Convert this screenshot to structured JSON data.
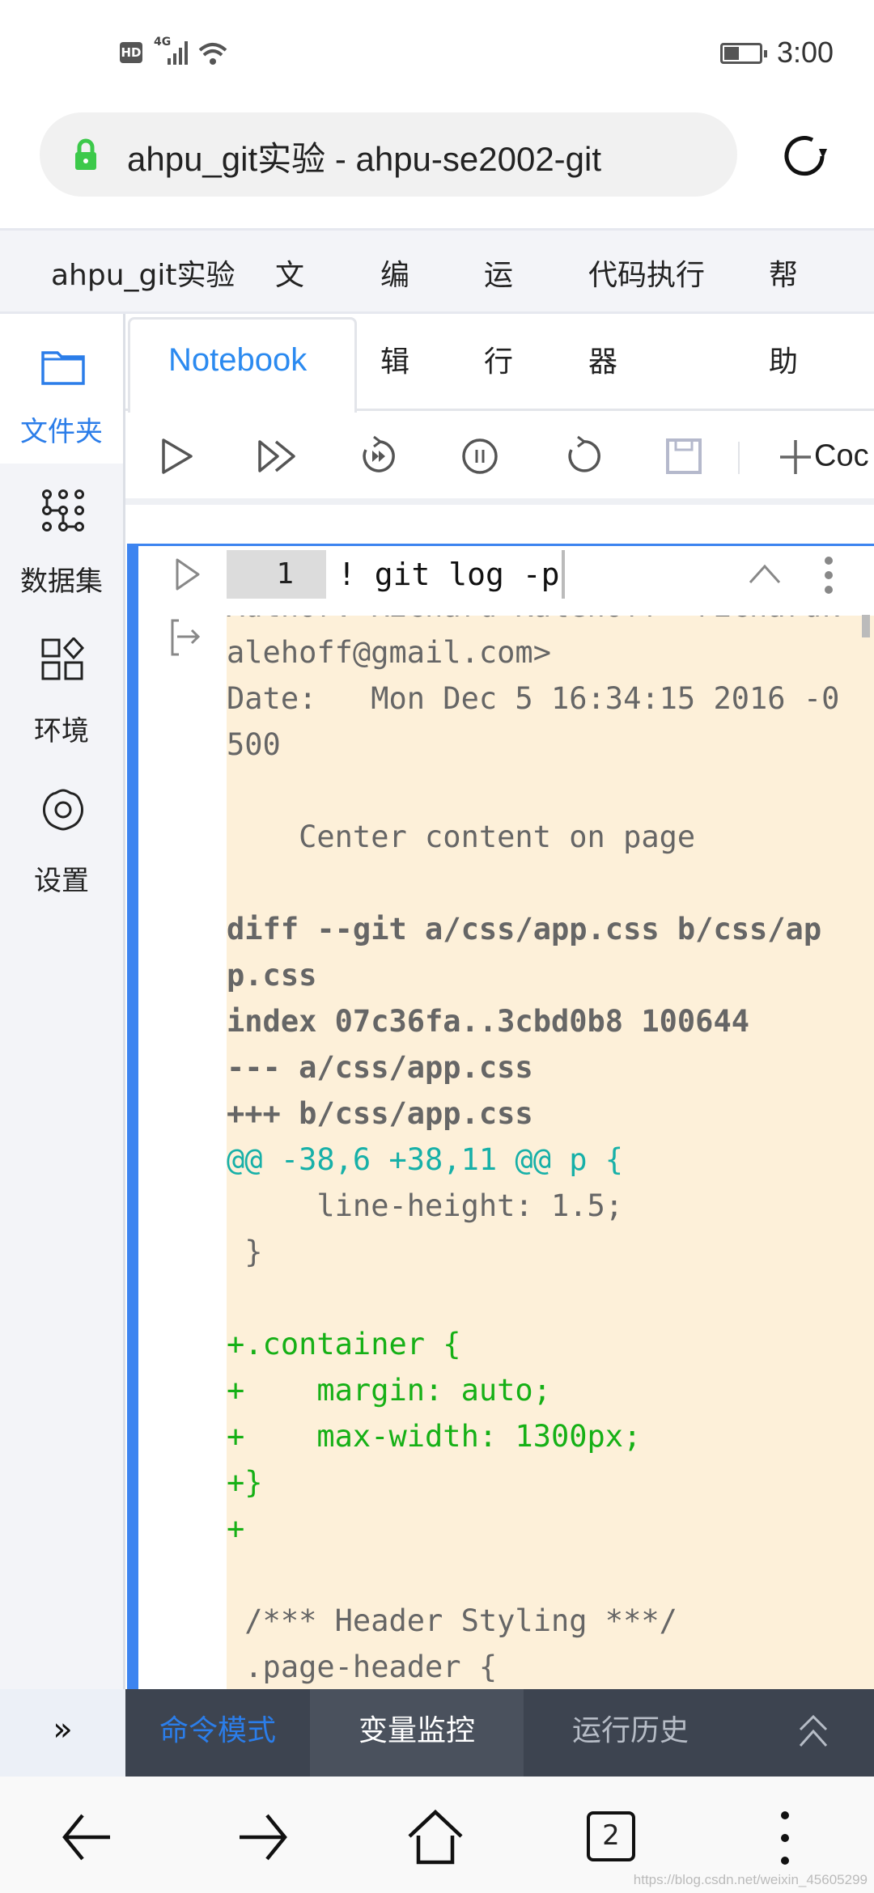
{
  "status_bar": {
    "hd": "HD",
    "network": "4G",
    "time": "3:00",
    "battery_percent": 40
  },
  "browser": {
    "url_title": "ahpu_git实验 - ahpu-se2002-git",
    "tab_count": "2"
  },
  "menu": {
    "project": "ahpu_git实验",
    "items": [
      "文",
      "编",
      "运",
      "代码执行",
      "帮"
    ],
    "items_row2": [
      "辑",
      "行",
      "器",
      "助"
    ]
  },
  "sidebar": {
    "items": [
      {
        "label": "文件夹",
        "icon": "folder-icon",
        "active": true
      },
      {
        "label": "数据集",
        "icon": "dataset-icon"
      },
      {
        "label": "环境",
        "icon": "environment-icon"
      },
      {
        "label": "设置",
        "icon": "settings-icon"
      }
    ]
  },
  "tabs": {
    "active": "Notebook"
  },
  "toolbar": {
    "add_code_label": "Coc"
  },
  "cell": {
    "line_number": "1",
    "code": "! git log -p"
  },
  "output": {
    "lines": [
      {
        "text": "Author: Richard Kalehoff <richardk",
        "style": "normal"
      },
      {
        "text": "alehoff@gmail.com>",
        "style": "normal"
      },
      {
        "text": "Date:   Mon Dec 5 16:34:15 2016 -0",
        "style": "normal"
      },
      {
        "text": "500",
        "style": "normal"
      },
      {
        "text": "",
        "style": "normal"
      },
      {
        "text": "    Center content on page",
        "style": "normal"
      },
      {
        "text": "",
        "style": "normal"
      },
      {
        "text": "diff --git a/css/app.css b/css/ap",
        "style": "bold"
      },
      {
        "text": "p.css",
        "style": "bold"
      },
      {
        "text": "index 07c36fa..3cbd0b8 100644",
        "style": "bold"
      },
      {
        "text": "--- a/css/app.css",
        "style": "bold"
      },
      {
        "text": "+++ b/css/app.css",
        "style": "bold"
      },
      {
        "text": "@@ -38,6 +38,11 @@",
        "suffix": " p {",
        "style": "hunk"
      },
      {
        "text": "     line-height: 1.5;",
        "style": "normal"
      },
      {
        "text": " }",
        "style": "normal"
      },
      {
        "text": "",
        "style": "normal"
      },
      {
        "text": "+.container {",
        "style": "green"
      },
      {
        "text": "+    margin: auto;",
        "style": "green"
      },
      {
        "text": "+    max-width: 1300px;",
        "style": "green"
      },
      {
        "text": "+}",
        "style": "green"
      },
      {
        "text": "+",
        "style": "green"
      },
      {
        "text": "",
        "style": "normal"
      },
      {
        "text": " /*** Header Styling ***/",
        "style": "normal"
      },
      {
        "text": " .page-header {",
        "style": "normal"
      }
    ]
  },
  "bottom_panel": {
    "tabs": [
      "命令模式",
      "变量监控",
      "运行历史"
    ],
    "active": "变量监控",
    "collapse_label": "»"
  },
  "colors": {
    "accent": "#2b7de9",
    "cell_border": "#3d84f0",
    "output_bg": "#fdf0d9",
    "diff_add": "#16b016",
    "diff_hunk": "#17b0a8",
    "panel_bg": "#3d4450"
  },
  "watermark": "https://blog.csdn.net/weixin_45605299"
}
